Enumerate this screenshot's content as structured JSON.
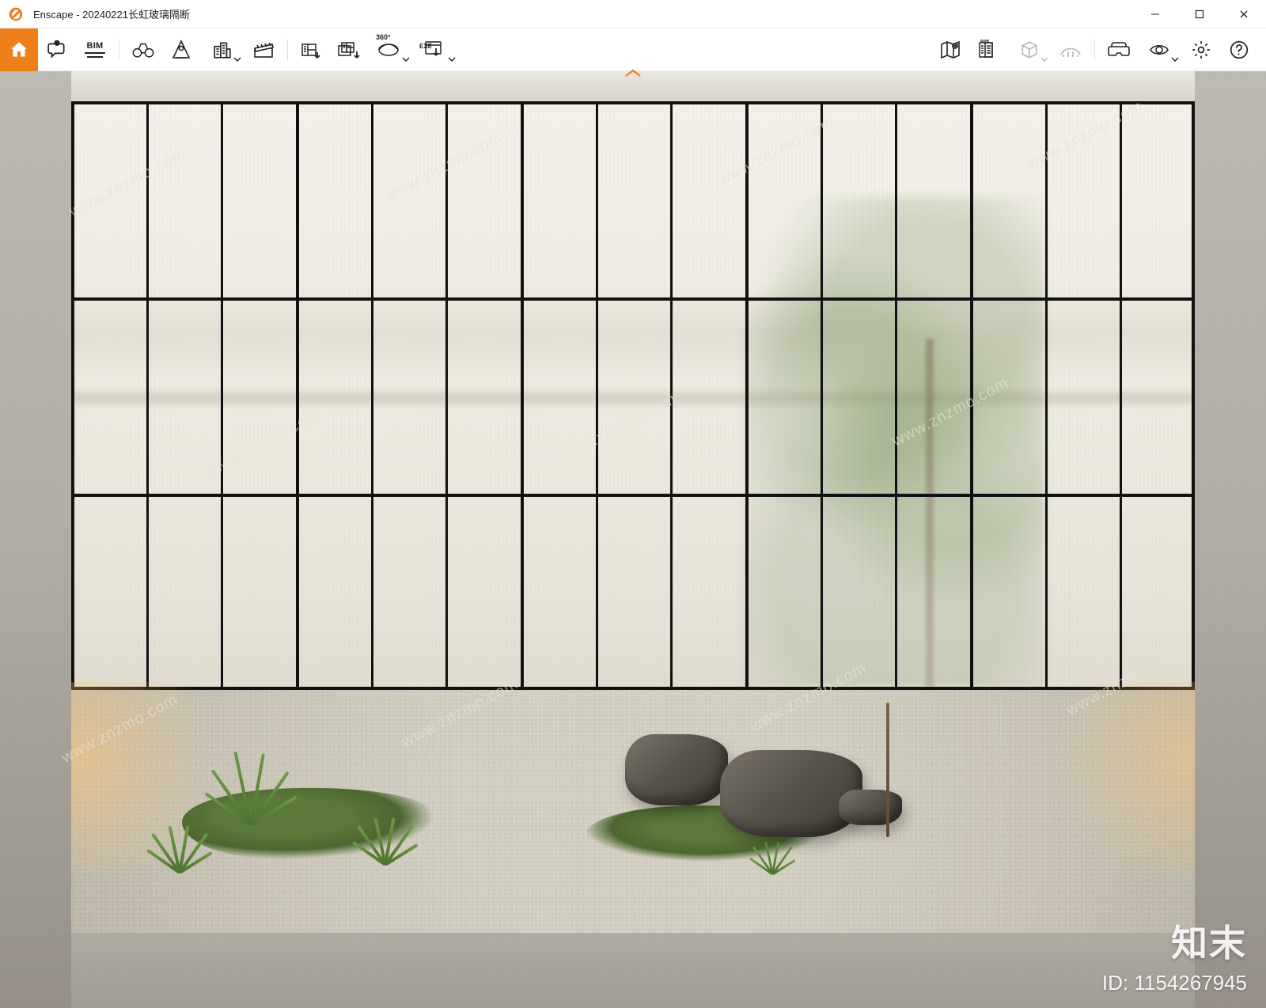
{
  "window": {
    "app_name": "Enscape",
    "title_separator": " - ",
    "document_title": "20240221长虹玻璃隔断"
  },
  "toolbar": {
    "home": "Home",
    "speech": "Speech Bubble",
    "bim_label": "BIM",
    "binoculars": "Binoculars",
    "headlight": "Headlight",
    "buildings": "Manage Views",
    "clapper": "Video Editor",
    "export_image": "Export Image",
    "batch_export": "Batch Export",
    "pano_label": "360°",
    "export_exe": "Export EXE",
    "exe_label": "EXE",
    "map": "Mini Map",
    "bim_panel": "BIM Info Panel",
    "cube": "View Cube",
    "bridge": "Walk Mode",
    "vr": "VR Headset",
    "visual_settings": "Visual Settings",
    "settings": "Settings",
    "help": "Help"
  },
  "window_controls": {
    "minimize": "Minimize",
    "maximize": "Maximize",
    "close": "Close"
  },
  "watermark": {
    "brand": "知末",
    "id_label": "ID: 1154267945",
    "url": "www.znzmo.com"
  },
  "colors": {
    "accent": "#ef7f1a"
  }
}
